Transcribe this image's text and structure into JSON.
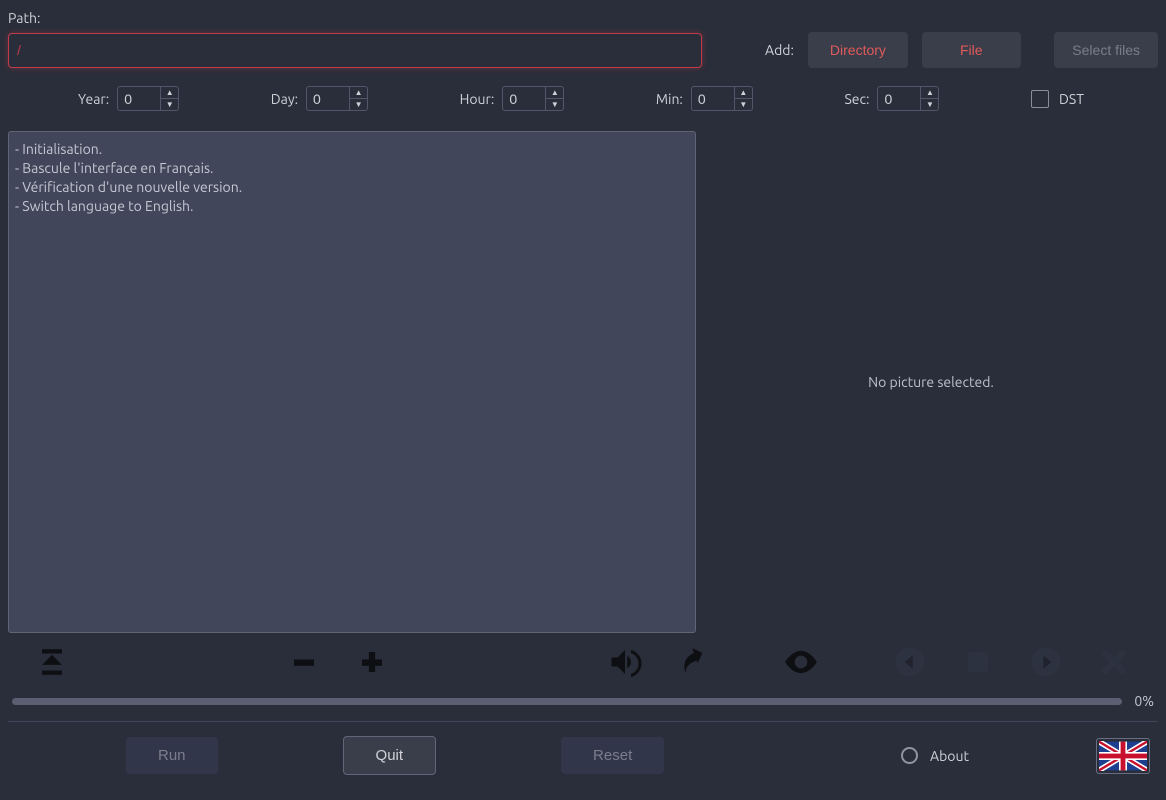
{
  "path": {
    "label": "Path:",
    "value": "/"
  },
  "add": {
    "label": "Add:",
    "directory": "Directory",
    "file": "File"
  },
  "select_files": "Select files",
  "time": {
    "year": {
      "label": "Year:",
      "value": "0"
    },
    "day": {
      "label": "Day:",
      "value": "0"
    },
    "hour": {
      "label": "Hour:",
      "value": "0"
    },
    "min": {
      "label": "Min:",
      "value": "0"
    },
    "sec": {
      "label": "Sec:",
      "value": "0"
    },
    "dst": "DST"
  },
  "log": [
    "- Initialisation.",
    "- Bascule l'interface en Français.",
    "- Vérification d'une nouvelle version.",
    "- Switch language to English."
  ],
  "preview_empty": "No picture selected.",
  "progress": {
    "pct": "0%"
  },
  "footer": {
    "run": "Run",
    "quit": "Quit",
    "reset": "Reset",
    "about": "About"
  }
}
